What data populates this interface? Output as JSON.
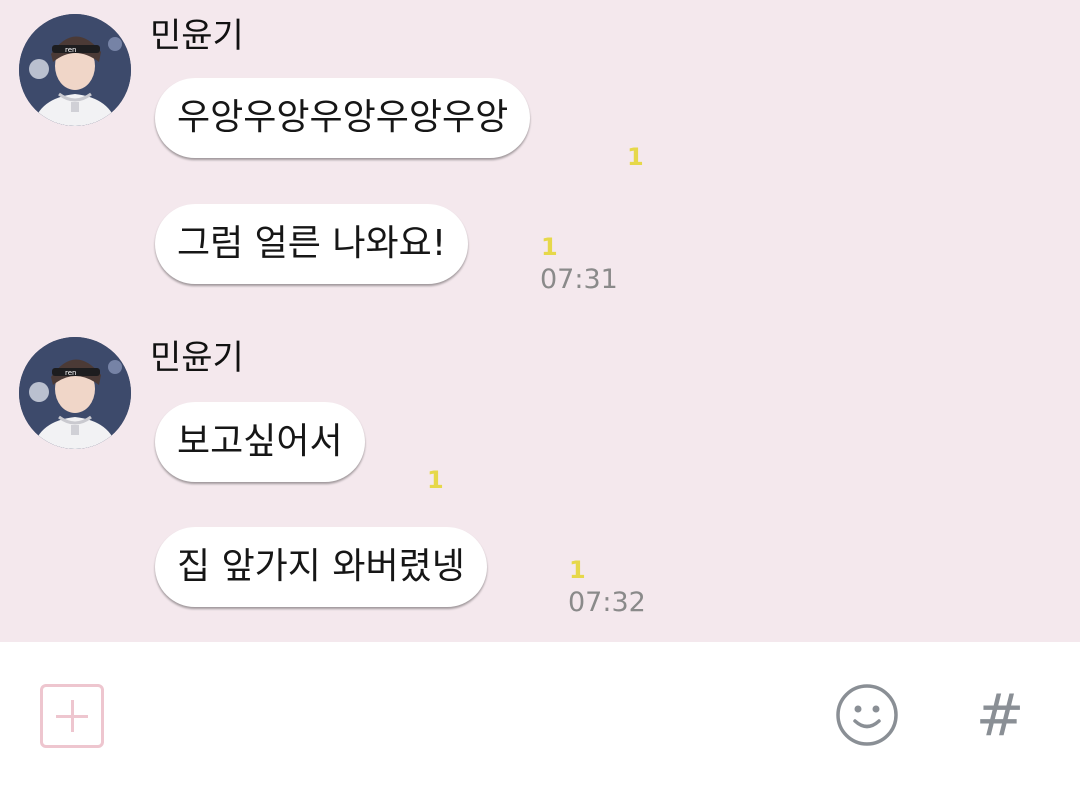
{
  "messages": [
    {
      "sender": "민윤기",
      "bubbles": [
        {
          "text": "우앙우앙우앙우앙우앙",
          "unread": "1",
          "time": ""
        },
        {
          "text": "그럼 얼른 나와요!",
          "unread": "1",
          "time": "07:31"
        }
      ]
    },
    {
      "sender": "민윤기",
      "bubbles": [
        {
          "text": "보고싶어서",
          "unread": "1",
          "time": ""
        },
        {
          "text": "집 앞가지 와버렸넹",
          "unread": "1",
          "time": "07:32"
        }
      ]
    }
  ],
  "input_bar": {
    "hash_label": "#",
    "plus_icon": "plus-icon",
    "emoji_icon": "smiley-icon"
  },
  "colors": {
    "chat_background": "#f4e8ed",
    "bubble": "#ffffff",
    "unread": "#e6d84a",
    "time": "#8a8a8a",
    "plus_accent": "#eec6cf"
  }
}
